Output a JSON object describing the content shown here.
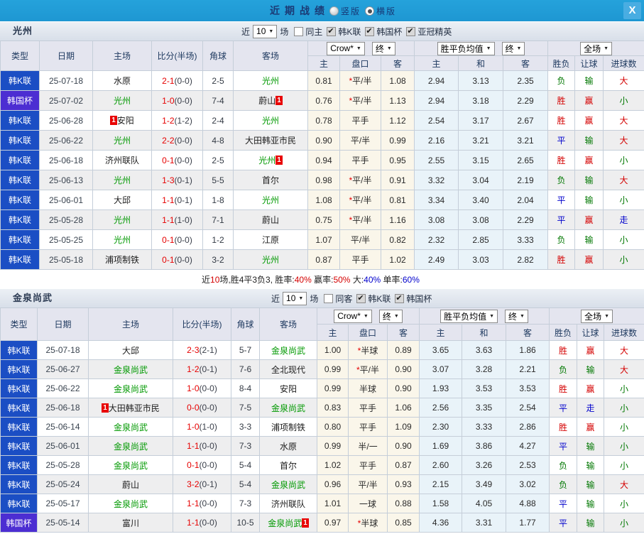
{
  "topbar": {
    "title": "近期战绩",
    "radios": [
      {
        "label": "竖版",
        "selected": false
      },
      {
        "label": "横版",
        "selected": true
      }
    ],
    "close_label": "X"
  },
  "sections": [
    {
      "team": "光州",
      "controls": {
        "prefix": "近",
        "count": "10",
        "suffix": "场",
        "checkboxes": [
          {
            "label": "同主",
            "checked": false
          },
          {
            "label": "韩K联",
            "checked": true
          },
          {
            "label": "韩国杯",
            "checked": true
          },
          {
            "label": "亚冠精英",
            "checked": true
          }
        ]
      },
      "dropdowns": {
        "book": "Crow*",
        "final1": "终",
        "avg": "胜平负均值",
        "final2": "终",
        "scope": "全场"
      },
      "columns": [
        "类型",
        "日期",
        "主场",
        "比分(半场)",
        "角球",
        "客场",
        "主",
        "盘口",
        "客",
        "主",
        "和",
        "客",
        "胜负",
        "让球",
        "进球数"
      ],
      "rows": [
        {
          "type": "韩K联",
          "tc": "blue",
          "date": "25-07-18",
          "home": {
            "name": "水原"
          },
          "ft": "2-1",
          "ht": "(0-0)",
          "corner": "2-5",
          "away": {
            "name": "光州",
            "hl": true
          },
          "o1": "0.81",
          "star": true,
          "hc": "平/半",
          "o2": "1.08",
          "avg": [
            "2.94",
            "3.13",
            "2.35"
          ],
          "res": [
            [
              "负",
              "g"
            ],
            [
              "输",
              "g"
            ],
            [
              "大",
              "r"
            ]
          ]
        },
        {
          "type": "韩国杯",
          "tc": "purple",
          "date": "25-07-02",
          "home": {
            "name": "光州",
            "hl": true
          },
          "ft": "1-0",
          "ht": "(0-0)",
          "corner": "7-4",
          "away": {
            "name": "蔚山",
            "badge": "1",
            "badge_pos": "after"
          },
          "o1": "0.76",
          "star": true,
          "hc": "平/半",
          "o2": "1.13",
          "avg": [
            "2.94",
            "3.18",
            "2.29"
          ],
          "res": [
            [
              "胜",
              "r"
            ],
            [
              "赢",
              "r"
            ],
            [
              "小",
              "g"
            ]
          ]
        },
        {
          "type": "韩K联",
          "tc": "blue",
          "date": "25-06-28",
          "home": {
            "name": "安阳",
            "badge": "1",
            "badge_pos": "before"
          },
          "ft": "1-2",
          "ht": "(1-2)",
          "corner": "2-4",
          "away": {
            "name": "光州",
            "hl": true
          },
          "o1": "0.78",
          "star": false,
          "hc": "平手",
          "o2": "1.12",
          "avg": [
            "2.54",
            "3.17",
            "2.67"
          ],
          "res": [
            [
              "胜",
              "r"
            ],
            [
              "赢",
              "r"
            ],
            [
              "大",
              "r"
            ]
          ]
        },
        {
          "type": "韩K联",
          "tc": "blue",
          "date": "25-06-22",
          "home": {
            "name": "光州",
            "hl": true
          },
          "ft": "2-2",
          "ht": "(0-0)",
          "corner": "4-8",
          "away": {
            "name": "大田韩亚市民"
          },
          "o1": "0.90",
          "star": false,
          "hc": "平/半",
          "o2": "0.99",
          "avg": [
            "2.16",
            "3.21",
            "3.21"
          ],
          "res": [
            [
              "平",
              "b"
            ],
            [
              "输",
              "g"
            ],
            [
              "大",
              "r"
            ]
          ]
        },
        {
          "type": "韩K联",
          "tc": "blue",
          "date": "25-06-18",
          "home": {
            "name": "济州联队"
          },
          "ft": "0-1",
          "ht": "(0-0)",
          "corner": "2-5",
          "away": {
            "name": "光州",
            "hl": true,
            "badge": "1",
            "badge_pos": "after"
          },
          "o1": "0.94",
          "star": false,
          "hc": "平手",
          "o2": "0.95",
          "avg": [
            "2.55",
            "3.15",
            "2.65"
          ],
          "res": [
            [
              "胜",
              "r"
            ],
            [
              "赢",
              "r"
            ],
            [
              "小",
              "g"
            ]
          ]
        },
        {
          "type": "韩K联",
          "tc": "blue",
          "date": "25-06-13",
          "home": {
            "name": "光州",
            "hl": true
          },
          "ft": "1-3",
          "ht": "(0-1)",
          "corner": "5-5",
          "away": {
            "name": "首尔"
          },
          "o1": "0.98",
          "star": true,
          "hc": "平/半",
          "o2": "0.91",
          "avg": [
            "3.32",
            "3.04",
            "2.19"
          ],
          "res": [
            [
              "负",
              "g"
            ],
            [
              "输",
              "g"
            ],
            [
              "大",
              "r"
            ]
          ]
        },
        {
          "type": "韩K联",
          "tc": "blue",
          "date": "25-06-01",
          "home": {
            "name": "大邱"
          },
          "ft": "1-1",
          "ht": "(0-1)",
          "corner": "1-8",
          "away": {
            "name": "光州",
            "hl": true
          },
          "o1": "1.08",
          "star": true,
          "hc": "平/半",
          "o2": "0.81",
          "avg": [
            "3.34",
            "3.40",
            "2.04"
          ],
          "res": [
            [
              "平",
              "b"
            ],
            [
              "输",
              "g"
            ],
            [
              "小",
              "g"
            ]
          ]
        },
        {
          "type": "韩K联",
          "tc": "blue",
          "date": "25-05-28",
          "home": {
            "name": "光州",
            "hl": true
          },
          "ft": "1-1",
          "ht": "(1-0)",
          "corner": "7-1",
          "away": {
            "name": "蔚山"
          },
          "o1": "0.75",
          "star": true,
          "hc": "平/半",
          "o2": "1.16",
          "avg": [
            "3.08",
            "3.08",
            "2.29"
          ],
          "res": [
            [
              "平",
              "b"
            ],
            [
              "赢",
              "r"
            ],
            [
              "走",
              "b"
            ]
          ]
        },
        {
          "type": "韩K联",
          "tc": "blue",
          "date": "25-05-25",
          "home": {
            "name": "光州",
            "hl": true
          },
          "ft": "0-1",
          "ht": "(0-0)",
          "corner": "1-2",
          "away": {
            "name": "江原"
          },
          "o1": "1.07",
          "star": false,
          "hc": "平/半",
          "o2": "0.82",
          "avg": [
            "2.32",
            "2.85",
            "3.33"
          ],
          "res": [
            [
              "负",
              "g"
            ],
            [
              "输",
              "g"
            ],
            [
              "小",
              "g"
            ]
          ]
        },
        {
          "type": "韩K联",
          "tc": "blue",
          "date": "25-05-18",
          "home": {
            "name": "浦项制铁"
          },
          "ft": "0-1",
          "ht": "(0-0)",
          "corner": "3-2",
          "away": {
            "name": "光州",
            "hl": true
          },
          "o1": "0.87",
          "star": false,
          "hc": "平手",
          "o2": "1.02",
          "avg": [
            "2.49",
            "3.03",
            "2.82"
          ],
          "res": [
            [
              "胜",
              "r"
            ],
            [
              "赢",
              "r"
            ],
            [
              "小",
              "g"
            ]
          ]
        }
      ],
      "summary": [
        [
          "近",
          "k"
        ],
        [
          "10",
          "r"
        ],
        [
          "场,胜4平3负3, ",
          "k"
        ],
        [
          "胜率:",
          "k"
        ],
        [
          "40%",
          "r"
        ],
        [
          " 赢率:",
          "k"
        ],
        [
          "50%",
          "r"
        ],
        [
          " 大:",
          "k"
        ],
        [
          "40%",
          "b"
        ],
        [
          " 单率:",
          "k"
        ],
        [
          "60%",
          "b"
        ]
      ]
    },
    {
      "team": "金泉尚武",
      "controls": {
        "prefix": "近",
        "count": "10",
        "suffix": "场",
        "checkboxes": [
          {
            "label": "同客",
            "checked": false
          },
          {
            "label": "韩K联",
            "checked": true
          },
          {
            "label": "韩国杯",
            "checked": true
          }
        ]
      },
      "dropdowns": {
        "book": "Crow*",
        "final1": "终",
        "avg": "胜平负均值",
        "final2": "终",
        "scope": "全场"
      },
      "columns": [
        "类型",
        "日期",
        "主场",
        "比分(半场)",
        "角球",
        "客场",
        "主",
        "盘口",
        "客",
        "主",
        "和",
        "客",
        "胜负",
        "让球",
        "进球数"
      ],
      "rows": [
        {
          "type": "韩K联",
          "tc": "blue",
          "date": "25-07-18",
          "home": {
            "name": "大邱"
          },
          "ft": "2-3",
          "ht": "(2-1)",
          "corner": "5-7",
          "away": {
            "name": "金泉尚武",
            "hl": true
          },
          "o1": "1.00",
          "star": true,
          "hc": "半球",
          "o2": "0.89",
          "avg": [
            "3.65",
            "3.63",
            "1.86"
          ],
          "res": [
            [
              "胜",
              "r"
            ],
            [
              "赢",
              "r"
            ],
            [
              "大",
              "r"
            ]
          ]
        },
        {
          "type": "韩K联",
          "tc": "blue",
          "date": "25-06-27",
          "home": {
            "name": "金泉尚武",
            "hl": true
          },
          "ft": "1-2",
          "ht": "(0-1)",
          "corner": "7-6",
          "away": {
            "name": "全北现代"
          },
          "o1": "0.99",
          "star": true,
          "hc": "平/半",
          "o2": "0.90",
          "avg": [
            "3.07",
            "3.28",
            "2.21"
          ],
          "res": [
            [
              "负",
              "g"
            ],
            [
              "输",
              "g"
            ],
            [
              "大",
              "r"
            ]
          ]
        },
        {
          "type": "韩K联",
          "tc": "blue",
          "date": "25-06-22",
          "home": {
            "name": "金泉尚武",
            "hl": true
          },
          "ft": "1-0",
          "ht": "(0-0)",
          "corner": "8-4",
          "away": {
            "name": "安阳"
          },
          "o1": "0.99",
          "star": false,
          "hc": "半球",
          "o2": "0.90",
          "avg": [
            "1.93",
            "3.53",
            "3.53"
          ],
          "res": [
            [
              "胜",
              "r"
            ],
            [
              "赢",
              "r"
            ],
            [
              "小",
              "g"
            ]
          ]
        },
        {
          "type": "韩K联",
          "tc": "blue",
          "date": "25-06-18",
          "home": {
            "name": "大田韩亚市民",
            "badge": "1",
            "badge_pos": "before"
          },
          "ft": "0-0",
          "ht": "(0-0)",
          "corner": "7-5",
          "away": {
            "name": "金泉尚武",
            "hl": true
          },
          "o1": "0.83",
          "star": false,
          "hc": "平手",
          "o2": "1.06",
          "avg": [
            "2.56",
            "3.35",
            "2.54"
          ],
          "res": [
            [
              "平",
              "b"
            ],
            [
              "走",
              "b"
            ],
            [
              "小",
              "g"
            ]
          ]
        },
        {
          "type": "韩K联",
          "tc": "blue",
          "date": "25-06-14",
          "home": {
            "name": "金泉尚武",
            "hl": true
          },
          "ft": "1-0",
          "ht": "(1-0)",
          "corner": "3-3",
          "away": {
            "name": "浦项制铁"
          },
          "o1": "0.80",
          "star": false,
          "hc": "平手",
          "o2": "1.09",
          "avg": [
            "2.30",
            "3.33",
            "2.86"
          ],
          "res": [
            [
              "胜",
              "r"
            ],
            [
              "赢",
              "r"
            ],
            [
              "小",
              "g"
            ]
          ]
        },
        {
          "type": "韩K联",
          "tc": "blue",
          "date": "25-06-01",
          "home": {
            "name": "金泉尚武",
            "hl": true
          },
          "ft": "1-1",
          "ht": "(0-0)",
          "corner": "7-3",
          "away": {
            "name": "水原"
          },
          "o1": "0.99",
          "star": false,
          "hc": "半/一",
          "o2": "0.90",
          "avg": [
            "1.69",
            "3.86",
            "4.27"
          ],
          "res": [
            [
              "平",
              "b"
            ],
            [
              "输",
              "g"
            ],
            [
              "小",
              "g"
            ]
          ]
        },
        {
          "type": "韩K联",
          "tc": "blue",
          "date": "25-05-28",
          "home": {
            "name": "金泉尚武",
            "hl": true
          },
          "ft": "0-1",
          "ht": "(0-0)",
          "corner": "5-4",
          "away": {
            "name": "首尔"
          },
          "o1": "1.02",
          "star": false,
          "hc": "平手",
          "o2": "0.87",
          "avg": [
            "2.60",
            "3.26",
            "2.53"
          ],
          "res": [
            [
              "负",
              "g"
            ],
            [
              "输",
              "g"
            ],
            [
              "小",
              "g"
            ]
          ]
        },
        {
          "type": "韩K联",
          "tc": "blue",
          "date": "25-05-24",
          "home": {
            "name": "蔚山"
          },
          "ft": "3-2",
          "ht": "(0-1)",
          "corner": "5-4",
          "away": {
            "name": "金泉尚武",
            "hl": true
          },
          "o1": "0.96",
          "star": false,
          "hc": "平/半",
          "o2": "0.93",
          "avg": [
            "2.15",
            "3.49",
            "3.02"
          ],
          "res": [
            [
              "负",
              "g"
            ],
            [
              "输",
              "g"
            ],
            [
              "大",
              "r"
            ]
          ]
        },
        {
          "type": "韩K联",
          "tc": "blue",
          "date": "25-05-17",
          "home": {
            "name": "金泉尚武",
            "hl": true
          },
          "ft": "1-1",
          "ht": "(0-0)",
          "corner": "7-3",
          "away": {
            "name": "济州联队"
          },
          "o1": "1.01",
          "star": false,
          "hc": "一球",
          "o2": "0.88",
          "avg": [
            "1.58",
            "4.05",
            "4.88"
          ],
          "res": [
            [
              "平",
              "b"
            ],
            [
              "输",
              "g"
            ],
            [
              "小",
              "g"
            ]
          ]
        },
        {
          "type": "韩国杯",
          "tc": "purple",
          "date": "25-05-14",
          "home": {
            "name": "富川"
          },
          "ft": "1-1",
          "ht": "(0-0)",
          "corner": "10-5",
          "away": {
            "name": "金泉尚武",
            "hl": true,
            "badge": "1",
            "badge_pos": "after"
          },
          "o1": "0.97",
          "star": true,
          "hc": "半球",
          "o2": "0.85",
          "avg": [
            "4.36",
            "3.31",
            "1.77"
          ],
          "res": [
            [
              "平",
              "b"
            ],
            [
              "输",
              "g"
            ],
            [
              "小",
              "g"
            ]
          ]
        }
      ],
      "summary": null
    }
  ]
}
